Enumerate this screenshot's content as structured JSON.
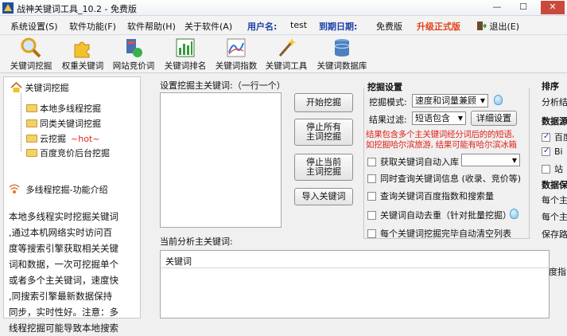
{
  "window": {
    "title": "战神关键词工具_10.2 - 免费版",
    "minimize": "—",
    "maximize": "☐",
    "close": "✕"
  },
  "menu": {
    "settings": "系统设置(S)",
    "features": "软件功能(F)",
    "help": "软件帮助(H)",
    "about": "关于软件(A)",
    "user_label": "用户名:",
    "user_value": "test",
    "expiry_label": "到期日期:",
    "expiry_value": "免费版",
    "upgrade": "升级正式版",
    "exit": "退出(E)"
  },
  "toolbar": {
    "items": [
      "关键词挖掘",
      "权重关键词",
      "网站竞价词",
      "关键词排名",
      "关键词指数",
      "关键词工具",
      "关键词数据库"
    ]
  },
  "left": {
    "root": "关键词挖掘",
    "items": [
      "本地多线程挖掘",
      "同类关键词挖掘",
      "云挖掘",
      "百度竞价后台挖掘"
    ],
    "hot": "~hot~",
    "intro_title": "多线程挖掘-功能介绍",
    "intro_lines": [
      "本地多线程实时挖掘关键词",
      ",通过本机网络实时访问百",
      "度等搜索引擎获取相关关键",
      "词和数据，一次可挖掘单个",
      "或者多个主关键词，速度快",
      ",同搜索引擎最新数据保持",
      "同步，实时性好。注意：多",
      "线程挖掘可能导致本地搜索"
    ]
  },
  "main": {
    "set_label": "设置挖掘主关键词:（一行一个）",
    "start": "开始挖掘",
    "stop_all_1": "停止所有",
    "stop_all_2": "主词挖掘",
    "stop_cur_1": "停止当前",
    "stop_cur_2": "主词挖掘",
    "import": "导入关键词",
    "current_label": "当前分析主关键词:",
    "col_keyword": "关键词"
  },
  "settings": {
    "title": "挖掘设置",
    "mode_label": "挖掘模式:",
    "mode_value": "速度和词量兼顾",
    "filter_label": "结果过滤:",
    "filter_value": "短语包含",
    "detail_btn": "详细设置",
    "note_line1": "结果包含多个主关键词经分词后的的短语,",
    "note_line2": "如挖掘哈尔滨旅游, 结果可能有哈尔滨冰箱",
    "opt_import": "获取关键词自动入库",
    "opt_query": "同时查询关键词信息 (收录、竞价等)",
    "opt_index": "查询关键词百度指数和搜索量",
    "opt_dedup": "关键词自动去重（针对批量挖掘）",
    "opt_clear": "每个关键词挖掘完毕自动清空列表"
  },
  "right": {
    "sort_title": "排序",
    "sort_sub": "分析结",
    "data_title": "数据源",
    "src1": "百度",
    "src2": "Bi",
    "src3": "站",
    "data2": "数据保",
    "line1": "每个主",
    "line2": "每个主",
    "save_path": "保存路",
    "col2": "度指"
  }
}
